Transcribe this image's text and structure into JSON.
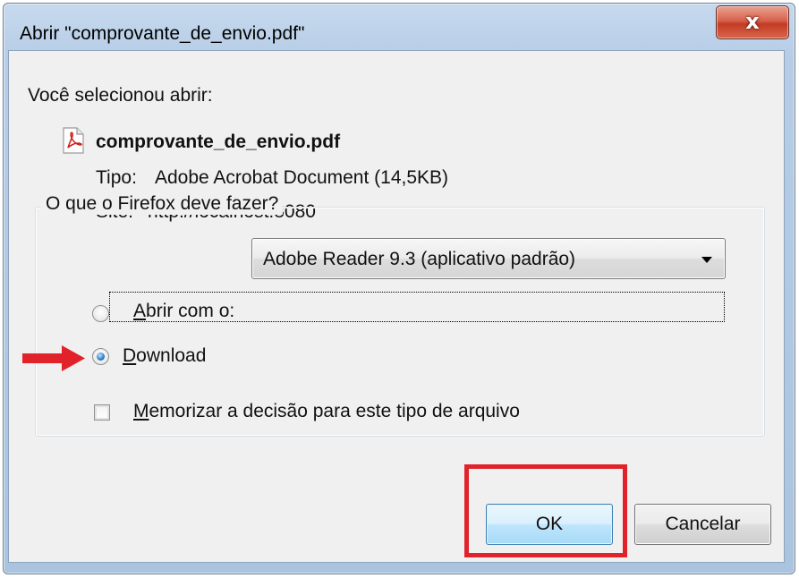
{
  "window": {
    "title": "Abrir \"comprovante_de_envio.pdf\"",
    "close_label": "x"
  },
  "info": {
    "intro": "Você selecionou abrir:",
    "filename": "comprovante_de_envio.pdf",
    "type_label": "Tipo:",
    "type_value": "Adobe Acrobat Document (14,5KB)",
    "site_label": "Site:",
    "site_value": "http://localhost:8080"
  },
  "action_group": {
    "legend": "O que o Firefox deve fazer?",
    "open_with_label_accel": "A",
    "open_with_label_rest": "brir com o:",
    "open_with_app": "Adobe Reader 9.3 (aplicativo padrão)",
    "download_label_accel": "D",
    "download_label_rest": "ownload",
    "selected": "download",
    "remember_label_accel": "M",
    "remember_label_rest": "emorizar a decisão para este tipo de arquivo",
    "remember_checked": false
  },
  "buttons": {
    "ok_label": "OK",
    "cancel_label": "Cancelar"
  },
  "colors": {
    "annotation_red": "#e1222a",
    "default_button_blue": "#3c7fb1"
  },
  "icons": {
    "file": "pdf-file-icon",
    "close": "close-icon",
    "dropdown": "chevron-down-icon",
    "annotation": "red-arrow-icon"
  }
}
